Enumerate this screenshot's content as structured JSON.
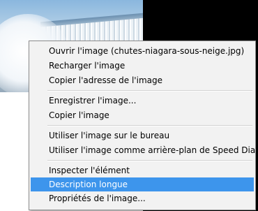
{
  "context_menu": {
    "items": [
      {
        "label": "Ouvrir l'image (chutes-niagara-sous-neige.jpg)",
        "highlighted": false
      },
      {
        "label": "Recharger l'image",
        "highlighted": false
      },
      {
        "label": "Copier l'adresse de l'image",
        "highlighted": false
      },
      {
        "label": "Enregistrer l'image...",
        "highlighted": false
      },
      {
        "label": "Copier l'image",
        "highlighted": false
      },
      {
        "label": "Utiliser l'image sur le bureau",
        "highlighted": false
      },
      {
        "label": "Utiliser l'image comme arrière-plan de Speed Dial",
        "highlighted": false
      },
      {
        "label": "Inspecter l'élément",
        "highlighted": false
      },
      {
        "label": "Description longue",
        "highlighted": true
      },
      {
        "label": "Propriétés de l'image...",
        "highlighted": false
      }
    ]
  },
  "colors": {
    "highlight": "#3d95ec",
    "menu_background": "#f2f2f2",
    "menu_border": "#8d8d8d"
  }
}
